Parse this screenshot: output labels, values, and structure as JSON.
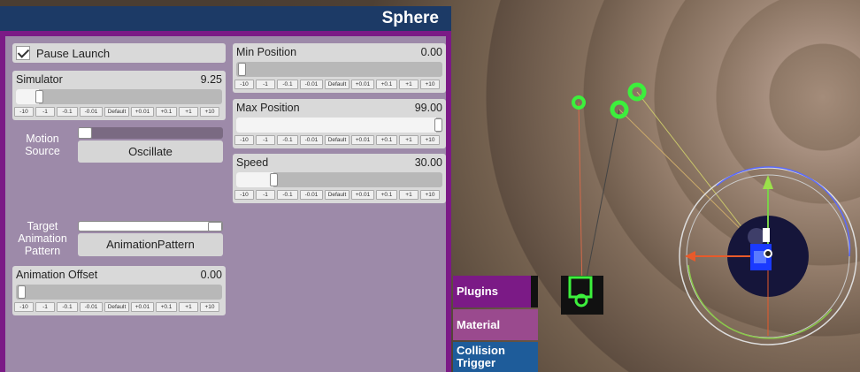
{
  "panel": {
    "title": "Sphere"
  },
  "pause_launch": {
    "label": "Pause Launch",
    "checked": true
  },
  "step_buttons": [
    "-10",
    "-1",
    "-0.1",
    "-0.01",
    "Default",
    "+0.01",
    "+0.1",
    "+1",
    "+10"
  ],
  "simulator": {
    "label": "Simulator",
    "value": "9.25",
    "fraction": 0.09
  },
  "motion_source": {
    "label": "Motion Source",
    "value": "Oscillate",
    "fraction": 0.0
  },
  "target_animation": {
    "label": "Target Animation Pattern",
    "value": "AnimationPattern",
    "fraction": 1.0
  },
  "animation_offset": {
    "label": "Animation Offset",
    "value": "0.00",
    "fraction": 0.0
  },
  "min_position": {
    "label": "Min Position",
    "value": "0.00",
    "fraction": 0.0
  },
  "max_position": {
    "label": "Max Position",
    "value": "99.00",
    "fraction": 0.99
  },
  "speed": {
    "label": "Speed",
    "value": "30.00",
    "fraction": 0.17
  },
  "side_tabs": [
    {
      "label": "Plugins",
      "color": "#7b1a86"
    },
    {
      "label": "Material",
      "color": "#9a4a8e"
    },
    {
      "label": "Collision Trigger",
      "color": "#1e5c9a"
    }
  ],
  "colors": {
    "header": "#1c3a66",
    "accent": "#7b1a86",
    "panel_bg": "#9d8aa9"
  }
}
